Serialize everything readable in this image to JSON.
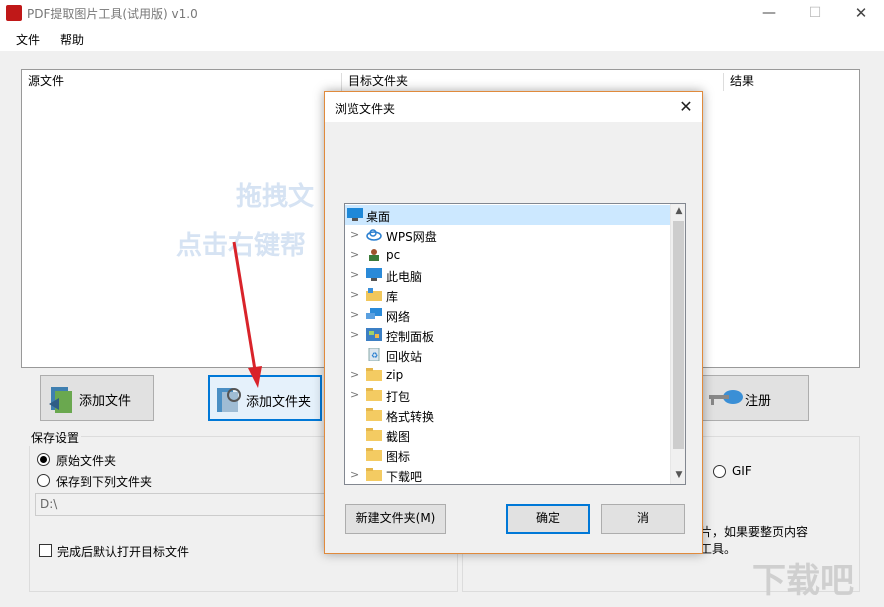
{
  "window": {
    "title": "PDF提取图片工具(试用版) v1.0",
    "min": "—",
    "max": "☐",
    "close": "✕"
  },
  "menu": {
    "file": "文件",
    "help": "帮助"
  },
  "table": {
    "columns": [
      "源文件",
      "目标文件夹",
      "结果"
    ],
    "hint_line1": "拖拽文",
    "hint_line2": "点击右键帮"
  },
  "buttons": {
    "add_file": "添加文件",
    "add_folder": "添加文件夹",
    "register": "注册"
  },
  "save_settings": {
    "title": "保存设置",
    "option_original": "原始文件夹",
    "option_custom": "保存到下列文件夹",
    "path_value": "D:\\",
    "open_after": "完成后默认打开目标文件",
    "selected": "original"
  },
  "right_panel": {
    "format_gif": "GIF",
    "note_line1": "片，如果要整页内容",
    "note_line2": "工具。"
  },
  "dialog": {
    "title": "浏览文件夹",
    "close": "✕",
    "tree": [
      {
        "label": "桌面",
        "icon": "desktop-icon",
        "expandable": false,
        "selected": true
      },
      {
        "label": "WPS网盘",
        "icon": "cloud-icon",
        "expandable": true
      },
      {
        "label": "pc",
        "icon": "user-icon",
        "expandable": true
      },
      {
        "label": "此电脑",
        "icon": "computer-icon",
        "expandable": true
      },
      {
        "label": "库",
        "icon": "library-icon",
        "expandable": true
      },
      {
        "label": "网络",
        "icon": "network-icon",
        "expandable": true
      },
      {
        "label": "控制面板",
        "icon": "control-panel-icon",
        "expandable": true
      },
      {
        "label": "回收站",
        "icon": "recycle-bin-icon",
        "expandable": false
      },
      {
        "label": "zip",
        "icon": "folder-icon",
        "expandable": true
      },
      {
        "label": "打包",
        "icon": "folder-icon",
        "expandable": true
      },
      {
        "label": "格式转换",
        "icon": "folder-icon",
        "expandable": false
      },
      {
        "label": "截图",
        "icon": "folder-icon",
        "expandable": false
      },
      {
        "label": "图标",
        "icon": "folder-icon",
        "expandable": false
      },
      {
        "label": "下载吧",
        "icon": "folder-icon",
        "expandable": true
      }
    ],
    "new_folder": "新建文件夹(M)",
    "ok": "确定",
    "cancel": "消"
  },
  "watermark": "下载吧",
  "colors": {
    "accent": "#0078d7",
    "dialog_border": "#e08a3c",
    "selection": "#cce8ff",
    "arrow": "#d9232a"
  }
}
